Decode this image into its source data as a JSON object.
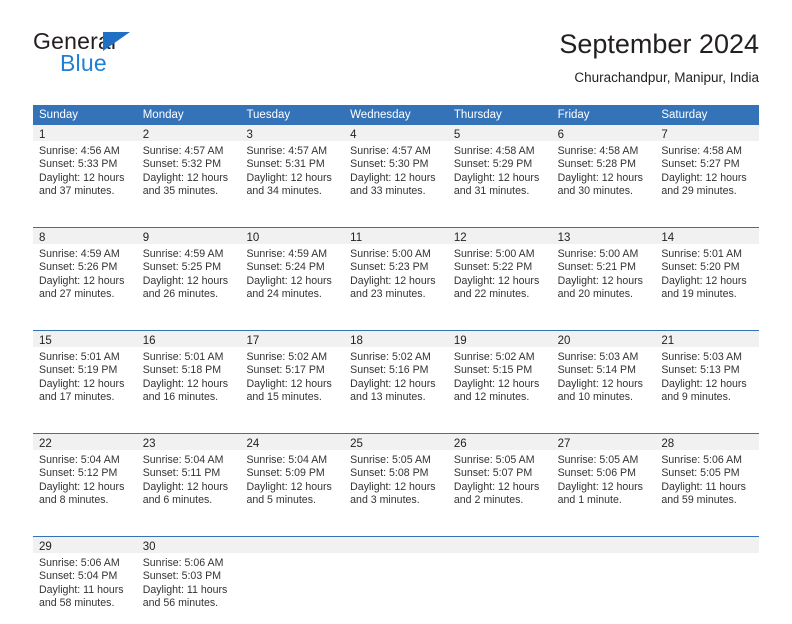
{
  "brand": {
    "word_dark": "General",
    "word_blue": "Blue",
    "accent_color": "#1f7fd4",
    "header_blue": "#3573b9"
  },
  "header": {
    "title": "September 2024",
    "subtitle": "Churachandpur, Manipur, India"
  },
  "weekdays": [
    "Sunday",
    "Monday",
    "Tuesday",
    "Wednesday",
    "Thursday",
    "Friday",
    "Saturday"
  ],
  "weeks": [
    [
      {
        "date": "1",
        "lines": [
          "Sunrise: 4:56 AM",
          "Sunset: 5:33 PM",
          "Daylight: 12 hours",
          "and 37 minutes."
        ]
      },
      {
        "date": "2",
        "lines": [
          "Sunrise: 4:57 AM",
          "Sunset: 5:32 PM",
          "Daylight: 12 hours",
          "and 35 minutes."
        ]
      },
      {
        "date": "3",
        "lines": [
          "Sunrise: 4:57 AM",
          "Sunset: 5:31 PM",
          "Daylight: 12 hours",
          "and 34 minutes."
        ]
      },
      {
        "date": "4",
        "lines": [
          "Sunrise: 4:57 AM",
          "Sunset: 5:30 PM",
          "Daylight: 12 hours",
          "and 33 minutes."
        ]
      },
      {
        "date": "5",
        "lines": [
          "Sunrise: 4:58 AM",
          "Sunset: 5:29 PM",
          "Daylight: 12 hours",
          "and 31 minutes."
        ]
      },
      {
        "date": "6",
        "lines": [
          "Sunrise: 4:58 AM",
          "Sunset: 5:28 PM",
          "Daylight: 12 hours",
          "and 30 minutes."
        ]
      },
      {
        "date": "7",
        "lines": [
          "Sunrise: 4:58 AM",
          "Sunset: 5:27 PM",
          "Daylight: 12 hours",
          "and 29 minutes."
        ]
      }
    ],
    [
      {
        "date": "8",
        "lines": [
          "Sunrise: 4:59 AM",
          "Sunset: 5:26 PM",
          "Daylight: 12 hours",
          "and 27 minutes."
        ]
      },
      {
        "date": "9",
        "lines": [
          "Sunrise: 4:59 AM",
          "Sunset: 5:25 PM",
          "Daylight: 12 hours",
          "and 26 minutes."
        ]
      },
      {
        "date": "10",
        "lines": [
          "Sunrise: 4:59 AM",
          "Sunset: 5:24 PM",
          "Daylight: 12 hours",
          "and 24 minutes."
        ]
      },
      {
        "date": "11",
        "lines": [
          "Sunrise: 5:00 AM",
          "Sunset: 5:23 PM",
          "Daylight: 12 hours",
          "and 23 minutes."
        ]
      },
      {
        "date": "12",
        "lines": [
          "Sunrise: 5:00 AM",
          "Sunset: 5:22 PM",
          "Daylight: 12 hours",
          "and 22 minutes."
        ]
      },
      {
        "date": "13",
        "lines": [
          "Sunrise: 5:00 AM",
          "Sunset: 5:21 PM",
          "Daylight: 12 hours",
          "and 20 minutes."
        ]
      },
      {
        "date": "14",
        "lines": [
          "Sunrise: 5:01 AM",
          "Sunset: 5:20 PM",
          "Daylight: 12 hours",
          "and 19 minutes."
        ]
      }
    ],
    [
      {
        "date": "15",
        "lines": [
          "Sunrise: 5:01 AM",
          "Sunset: 5:19 PM",
          "Daylight: 12 hours",
          "and 17 minutes."
        ]
      },
      {
        "date": "16",
        "lines": [
          "Sunrise: 5:01 AM",
          "Sunset: 5:18 PM",
          "Daylight: 12 hours",
          "and 16 minutes."
        ]
      },
      {
        "date": "17",
        "lines": [
          "Sunrise: 5:02 AM",
          "Sunset: 5:17 PM",
          "Daylight: 12 hours",
          "and 15 minutes."
        ]
      },
      {
        "date": "18",
        "lines": [
          "Sunrise: 5:02 AM",
          "Sunset: 5:16 PM",
          "Daylight: 12 hours",
          "and 13 minutes."
        ]
      },
      {
        "date": "19",
        "lines": [
          "Sunrise: 5:02 AM",
          "Sunset: 5:15 PM",
          "Daylight: 12 hours",
          "and 12 minutes."
        ]
      },
      {
        "date": "20",
        "lines": [
          "Sunrise: 5:03 AM",
          "Sunset: 5:14 PM",
          "Daylight: 12 hours",
          "and 10 minutes."
        ]
      },
      {
        "date": "21",
        "lines": [
          "Sunrise: 5:03 AM",
          "Sunset: 5:13 PM",
          "Daylight: 12 hours",
          "and 9 minutes."
        ]
      }
    ],
    [
      {
        "date": "22",
        "lines": [
          "Sunrise: 5:04 AM",
          "Sunset: 5:12 PM",
          "Daylight: 12 hours",
          "and 8 minutes."
        ]
      },
      {
        "date": "23",
        "lines": [
          "Sunrise: 5:04 AM",
          "Sunset: 5:11 PM",
          "Daylight: 12 hours",
          "and 6 minutes."
        ]
      },
      {
        "date": "24",
        "lines": [
          "Sunrise: 5:04 AM",
          "Sunset: 5:09 PM",
          "Daylight: 12 hours",
          "and 5 minutes."
        ]
      },
      {
        "date": "25",
        "lines": [
          "Sunrise: 5:05 AM",
          "Sunset: 5:08 PM",
          "Daylight: 12 hours",
          "and 3 minutes."
        ]
      },
      {
        "date": "26",
        "lines": [
          "Sunrise: 5:05 AM",
          "Sunset: 5:07 PM",
          "Daylight: 12 hours",
          "and 2 minutes."
        ]
      },
      {
        "date": "27",
        "lines": [
          "Sunrise: 5:05 AM",
          "Sunset: 5:06 PM",
          "Daylight: 12 hours",
          "and 1 minute."
        ]
      },
      {
        "date": "28",
        "lines": [
          "Sunrise: 5:06 AM",
          "Sunset: 5:05 PM",
          "Daylight: 11 hours",
          "and 59 minutes."
        ]
      }
    ],
    [
      {
        "date": "29",
        "lines": [
          "Sunrise: 5:06 AM",
          "Sunset: 5:04 PM",
          "Daylight: 11 hours",
          "and 58 minutes."
        ]
      },
      {
        "date": "30",
        "lines": [
          "Sunrise: 5:06 AM",
          "Sunset: 5:03 PM",
          "Daylight: 11 hours",
          "and 56 minutes."
        ]
      },
      {
        "date": "",
        "lines": []
      },
      {
        "date": "",
        "lines": []
      },
      {
        "date": "",
        "lines": []
      },
      {
        "date": "",
        "lines": []
      },
      {
        "date": "",
        "lines": []
      }
    ]
  ]
}
